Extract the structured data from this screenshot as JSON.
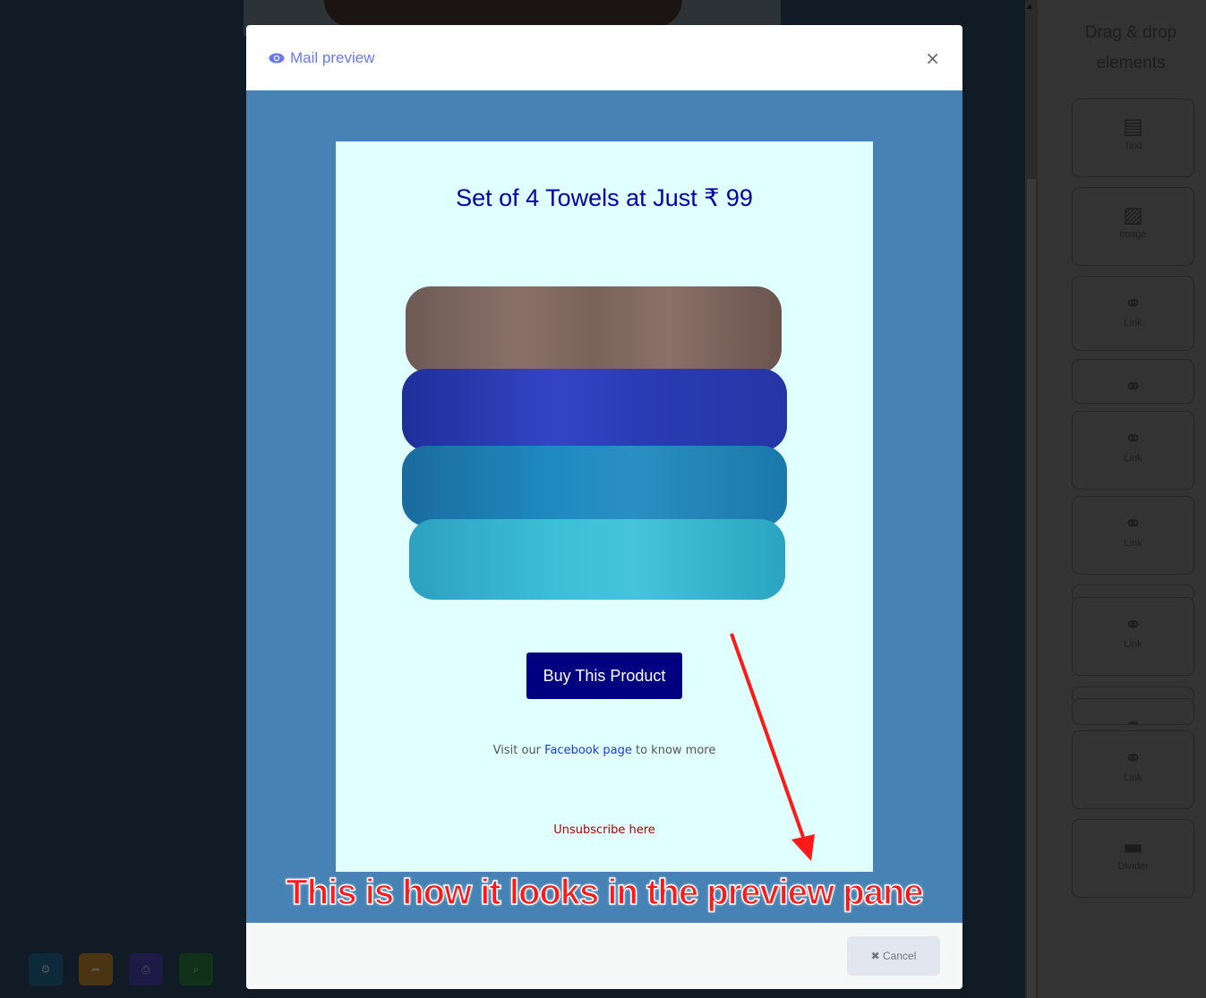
{
  "modal": {
    "title": "Mail preview",
    "title_icon": "eye-icon",
    "close_label": "×",
    "cancel_label": "Cancel",
    "cancel_icon": "x-icon"
  },
  "email": {
    "title": "Set of 4 Towels at Just ₹ 99",
    "image": "stack-of-towels",
    "buy_label": "Buy This Product",
    "visit_prefix": "Visit our ",
    "visit_link": "Facebook page",
    "visit_suffix": " to know more",
    "unsubscribe": "Unsubscribe here",
    "colors": {
      "background": "#e0ffff",
      "frame": "#4682b4",
      "title": "#0000aa",
      "button": "#000080",
      "unsubscribe": "#b00000"
    }
  },
  "annotation": "This is how it looks in the preview pane",
  "sidebar": {
    "title": "Drag & drop elements",
    "items": [
      {
        "label": "Text",
        "icon": "file-text-icon"
      },
      {
        "label": "Image",
        "icon": "image-icon"
      },
      {
        "label": "Link",
        "icon": "link-icon"
      },
      {
        "label": "",
        "icon": "link-icon"
      },
      {
        "label": "Link",
        "icon": "link-icon"
      },
      {
        "label": "Link",
        "icon": "link-icon"
      },
      {
        "label": "Link",
        "icon": "link-icon"
      },
      {
        "label": "",
        "icon": "link-icon"
      },
      {
        "label": "Link",
        "icon": "link-icon"
      },
      {
        "label": "Divider",
        "icon": "divider-icon"
      }
    ]
  },
  "toolbar": [
    {
      "icon": "gear-icon",
      "color": "#0d2a3a"
    },
    {
      "icon": "export-icon",
      "color": "#4a3412"
    },
    {
      "icon": "print-icon",
      "color": "#1d1a46"
    },
    {
      "icon": "zoom-icon",
      "color": "#113219"
    }
  ]
}
